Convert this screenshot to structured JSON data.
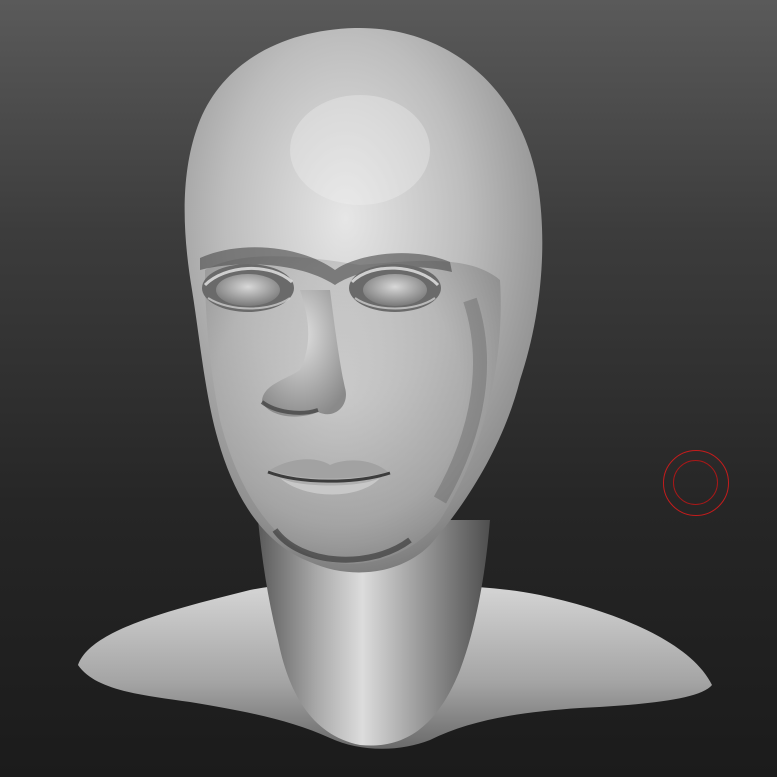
{
  "viewport": {
    "background_top": "#5a5a5a",
    "background_bottom": "#1b1b1b",
    "material_color": "#bdbdbd"
  },
  "model": {
    "type": "sculpted-head-bust"
  },
  "brush": {
    "icon": "circle-brush-cursor-icon",
    "outer_color": "#c41c1c",
    "inner_color": "#a81818"
  }
}
